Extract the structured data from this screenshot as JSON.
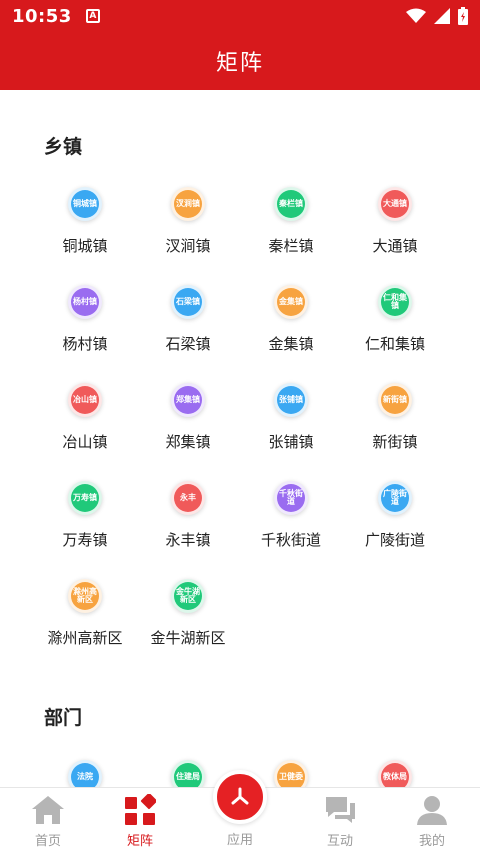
{
  "status": {
    "time": "10:53",
    "notification_glyph": "A"
  },
  "header": {
    "title": "矩阵"
  },
  "sections": {
    "towns": {
      "title": "乡镇",
      "items": [
        {
          "label": "铜城镇",
          "icon_text": "铜城镇",
          "color": "blue"
        },
        {
          "label": "汊涧镇",
          "icon_text": "汊涧镇",
          "color": "orange"
        },
        {
          "label": "秦栏镇",
          "icon_text": "秦栏镇",
          "color": "green"
        },
        {
          "label": "大通镇",
          "icon_text": "大通镇",
          "color": "red"
        },
        {
          "label": "杨村镇",
          "icon_text": "杨村镇",
          "color": "purple"
        },
        {
          "label": "石梁镇",
          "icon_text": "石梁镇",
          "color": "blue"
        },
        {
          "label": "金集镇",
          "icon_text": "金集镇",
          "color": "orange"
        },
        {
          "label": "仁和集镇",
          "icon_text": "仁和集镇",
          "color": "green"
        },
        {
          "label": "冶山镇",
          "icon_text": "冶山镇",
          "color": "red"
        },
        {
          "label": "郑集镇",
          "icon_text": "郑集镇",
          "color": "purple"
        },
        {
          "label": "张铺镇",
          "icon_text": "张铺镇",
          "color": "blue"
        },
        {
          "label": "新街镇",
          "icon_text": "新街镇",
          "color": "orange"
        },
        {
          "label": "万寿镇",
          "icon_text": "万寿镇",
          "color": "green"
        },
        {
          "label": "永丰镇",
          "icon_text": "永丰",
          "color": "red"
        },
        {
          "label": "千秋街道",
          "icon_text": "千秋街道",
          "color": "purple"
        },
        {
          "label": "广陵街道",
          "icon_text": "广陵街道",
          "color": "blue"
        },
        {
          "label": "滁州高新区",
          "icon_text": "滁州高新区",
          "color": "orange"
        },
        {
          "label": "金牛湖新区",
          "icon_text": "金牛湖新区",
          "color": "green"
        }
      ]
    },
    "departments": {
      "title": "部门",
      "items": [
        {
          "icon_text": "法院",
          "color": "blue"
        },
        {
          "icon_text": "住建局",
          "color": "green"
        },
        {
          "icon_text": "卫健委",
          "color": "orange"
        },
        {
          "icon_text": "教体局",
          "color": "red"
        }
      ]
    }
  },
  "colors": {
    "brand": "#d7191c",
    "blue": "#3aa8f2",
    "orange": "#f7a340",
    "green": "#20c97a",
    "red": "#f05a5a",
    "purple": "#9a6cf0"
  },
  "bottom_nav": [
    {
      "key": "home",
      "label": "首页",
      "icon": "home-icon",
      "active": false
    },
    {
      "key": "matrix",
      "label": "矩阵",
      "icon": "grid-icon",
      "active": true
    },
    {
      "key": "apps",
      "label": "应用",
      "icon": "apps-icon",
      "active": false
    },
    {
      "key": "interact",
      "label": "互动",
      "icon": "chat-icon",
      "active": false
    },
    {
      "key": "mine",
      "label": "我的",
      "icon": "user-icon",
      "active": false
    }
  ]
}
